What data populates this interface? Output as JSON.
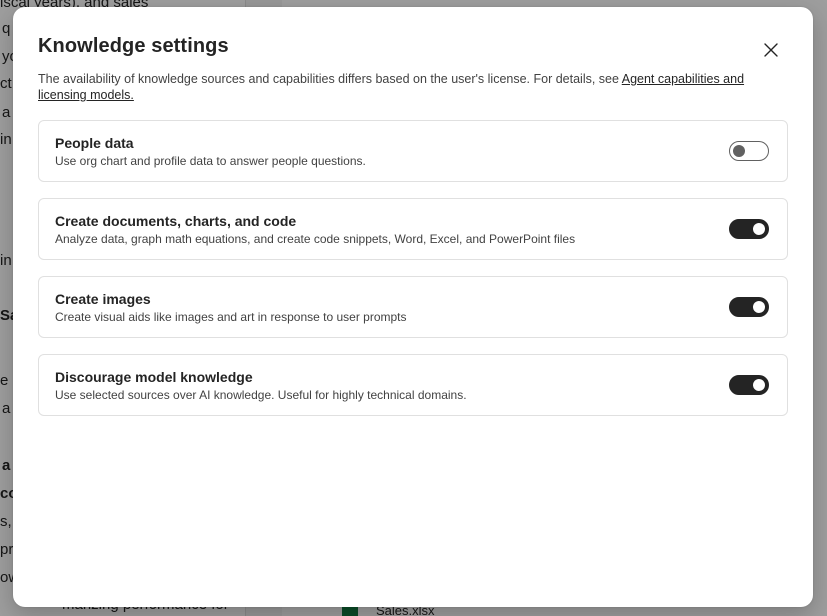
{
  "background": {
    "left_fragments": [
      "iscal years), and sales",
      "q",
      "yo",
      "ct",
      "a",
      "in",
      "in",
      "Sa",
      "e",
      "a",
      "a",
      "co",
      "s,",
      "pr",
      "ow",
      "marizing performance for"
    ],
    "right_fragments": [
      "Sales.xlsx"
    ]
  },
  "modal": {
    "title": "Knowledge settings",
    "close_label": "Close",
    "description_prefix": "The availability of knowledge sources and capabilities differs based on the user's license. For details, see ",
    "description_link": "Agent capabilities and licensing models.",
    "settings": [
      {
        "title": "People data",
        "subtitle": "Use org chart and profile data to answer people questions.",
        "enabled": false
      },
      {
        "title": "Create documents, charts, and code",
        "subtitle": "Analyze data, graph math equations, and create code snippets, Word, Excel, and PowerPoint files",
        "enabled": true
      },
      {
        "title": "Create images",
        "subtitle": "Create visual aids like images and art in response to user prompts",
        "enabled": true
      },
      {
        "title": "Discourage model knowledge",
        "subtitle": "Use selected sources over AI knowledge. Useful for highly technical domains.",
        "enabled": true
      }
    ]
  }
}
